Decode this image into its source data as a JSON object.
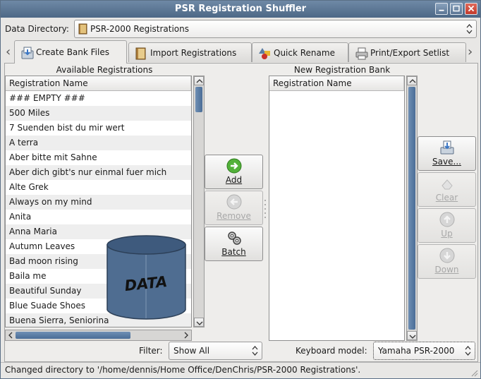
{
  "window": {
    "title": "PSR Registration Shuffler"
  },
  "data_directory": {
    "label": "Data Directory:",
    "value": "PSR-2000 Registrations"
  },
  "tabs": [
    {
      "label": "Create Bank Files",
      "icon": "bank-file-icon",
      "active": true
    },
    {
      "label": "Import Registrations",
      "icon": "book-icon",
      "active": false
    },
    {
      "label": "Quick Rename",
      "icon": "shapes-icon",
      "active": false
    },
    {
      "label": "Print/Export Setlist",
      "icon": "printer-icon",
      "active": false
    }
  ],
  "available": {
    "title": "Available Registrations",
    "column": "Registration Name",
    "rows": [
      "### EMPTY ###",
      "500 Miles",
      "7 Suenden bist du mir wert",
      "A terra",
      "Aber bitte mit Sahne",
      "Aber dich gibt's nur einmal fuer mich",
      "Alte Grek",
      "Always on my mind",
      "Anita",
      "Anna Maria",
      "Autumn Leaves",
      "Bad moon rising",
      "Baila me",
      "Beautiful Sunday",
      "Blue Suade Shoes",
      "Buena Sierra, Seniorina"
    ]
  },
  "middle_buttons": {
    "add": "Add",
    "remove": "Remove",
    "batch": "Batch"
  },
  "new_bank": {
    "title": "New Registration Bank",
    "column": "Registration Name",
    "rows": []
  },
  "right_buttons": {
    "save": "Save...",
    "clear": "Clear",
    "up": "Up",
    "down": "Down"
  },
  "overlay": {
    "text": "DATA",
    "icon": "database-cylinder-icon"
  },
  "filter": {
    "label": "Filter:",
    "value": "Show All"
  },
  "keyboard": {
    "label": "Keyboard model:",
    "value": "Yamaha PSR-2000"
  },
  "status": "Changed directory to '/home/dennis/Home Office/DenChris/PSR-2000 Registrations'.",
  "colors": {
    "titlebar": "#5a7594",
    "scroll_thumb": "#5a7ca3",
    "cylinder": "#4f6d91"
  }
}
